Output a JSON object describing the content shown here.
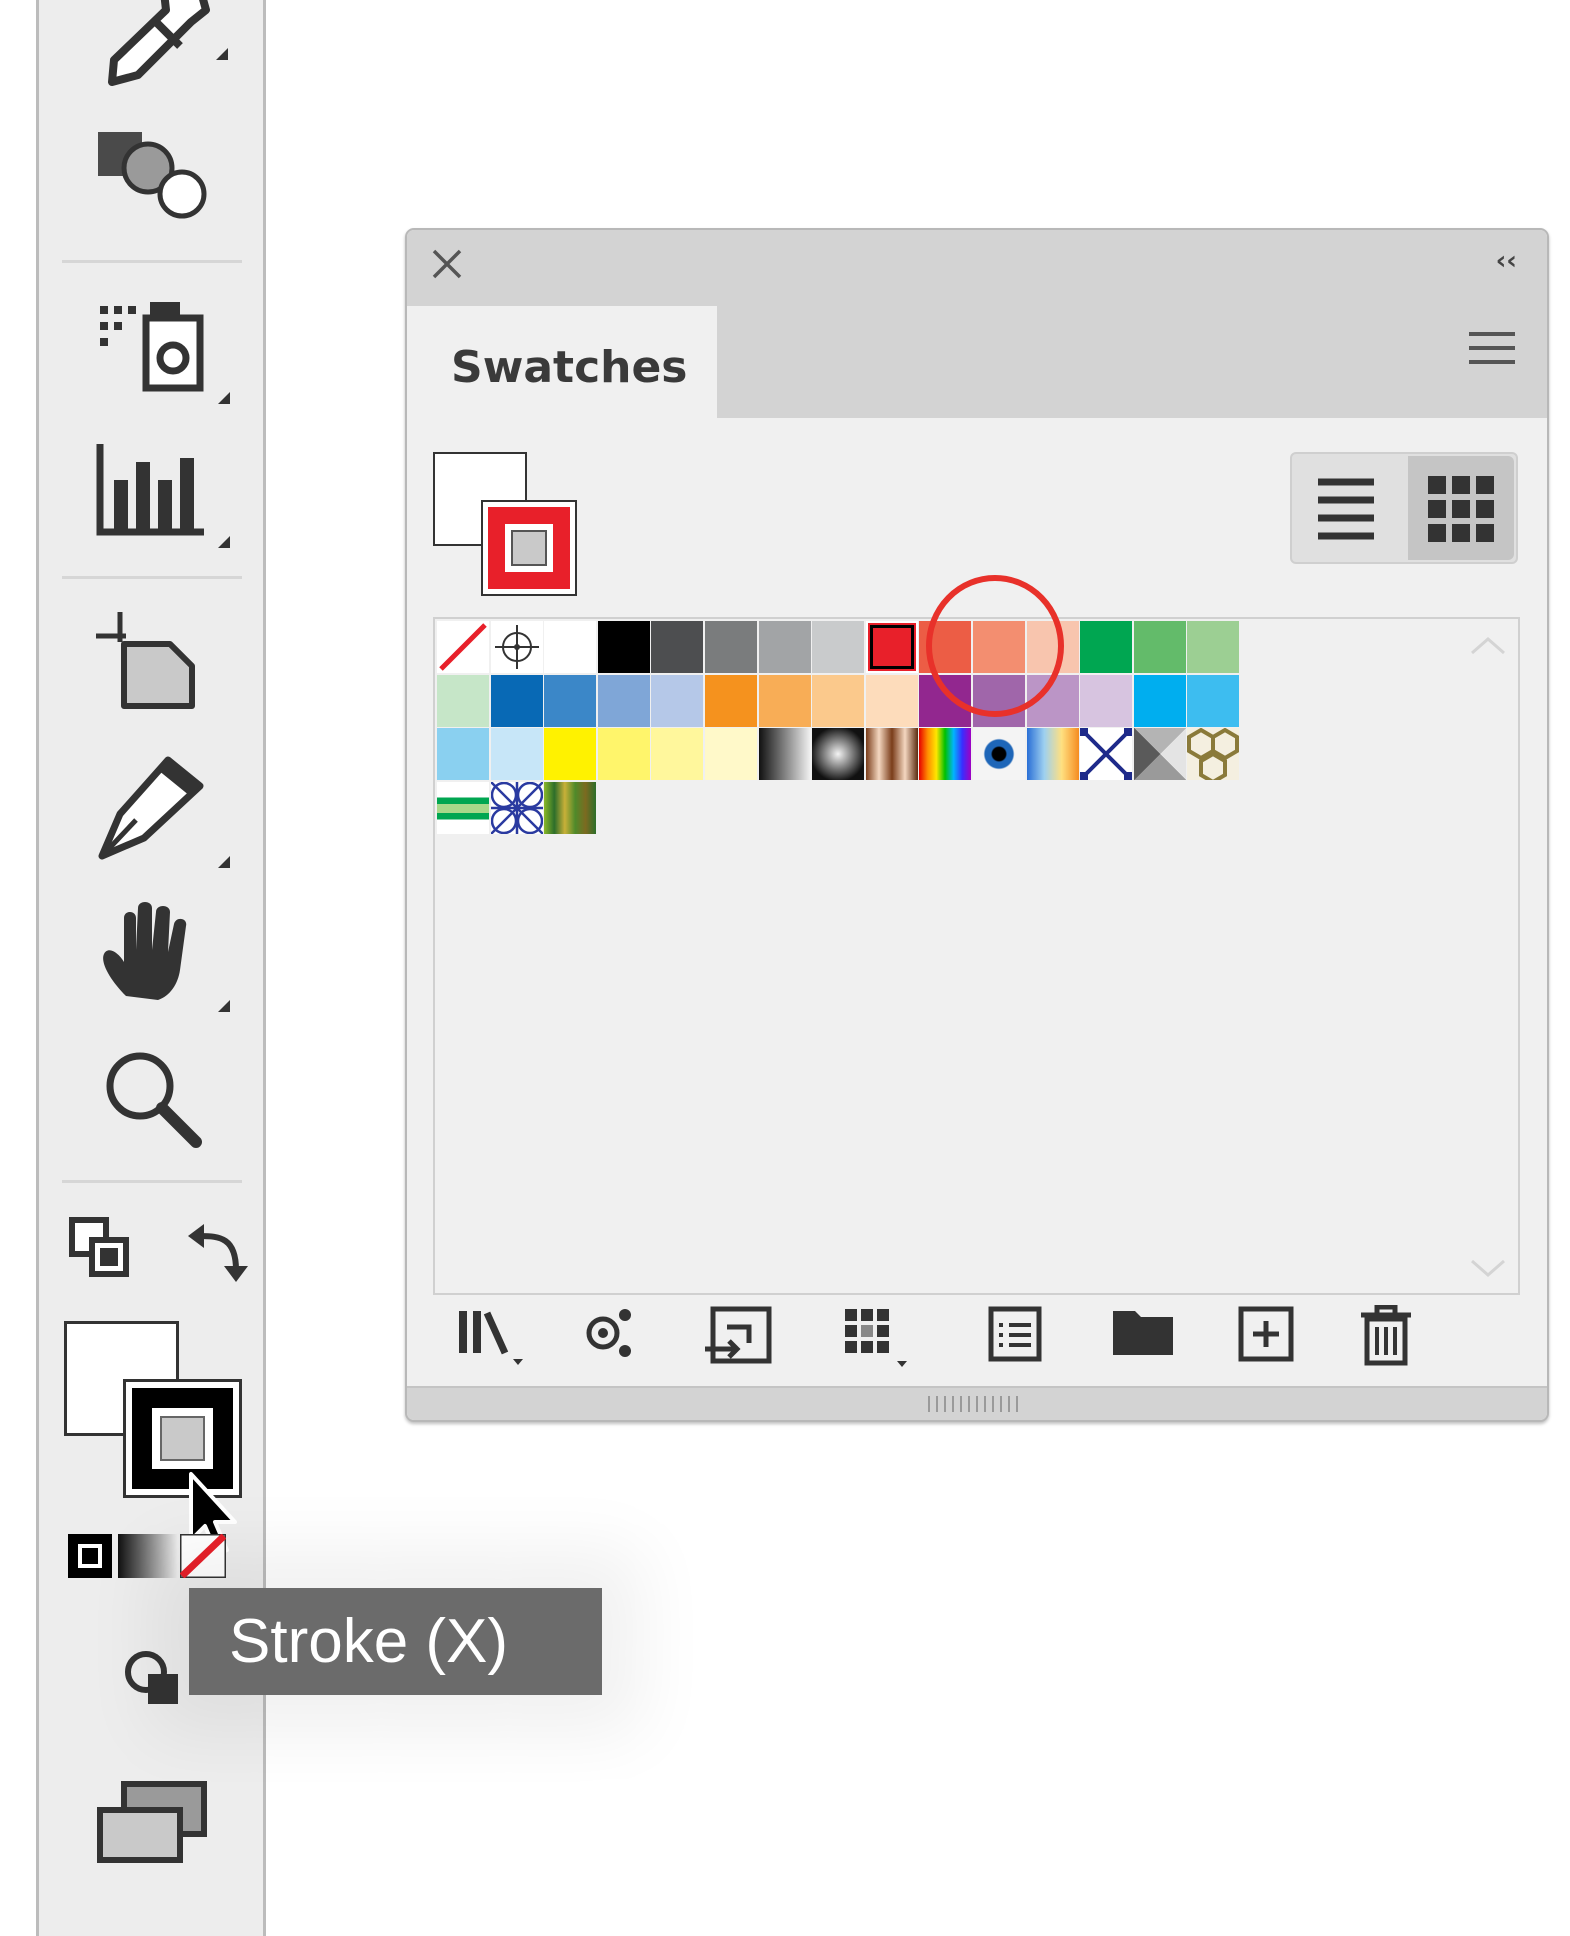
{
  "panel": {
    "tab_title": "Swatches",
    "collapse_glyph": "‹‹"
  },
  "tooltip": {
    "text": "Stroke (X)"
  },
  "colors": {
    "highlight_circle": "#e8312a",
    "selected_stroke": "#e8202a",
    "tooltip_bg": "#6b6b6b"
  },
  "icons": {
    "tools": [
      "eyedropper-icon",
      "shape-builder-icon",
      "symbol-sprayer-icon",
      "column-graph-icon",
      "artboard-icon",
      "slice-icon",
      "hand-icon",
      "zoom-icon",
      "default-fill-stroke-icon",
      "swap-fill-stroke-icon",
      "fill-swatch",
      "stroke-swatch",
      "color-mode-icon",
      "gradient-mode-icon",
      "none-mode-icon",
      "drawing-modes-icon",
      "screen-mode-icon"
    ],
    "panel_bottom": [
      "swatch-libraries-icon",
      "show-swatch-kinds-icon",
      "swatch-options-icon",
      "color-group-icon",
      "new-color-group-icon",
      "folder-icon",
      "new-swatch-icon",
      "delete-swatch-icon"
    ]
  },
  "swatches": {
    "row1": [
      "none",
      "registration",
      "#ffffff",
      "#000000",
      "#4d4e50",
      "#7a7c7d",
      "#a2a4a6",
      "#c9cbcc",
      "#e8202a",
      "#ec5d45",
      "#f38e70",
      "#f8c5ae",
      "#00a651",
      "#63bb6a",
      "#9ccf93"
    ],
    "row2": [
      "#c6e6c8",
      "#0869b5",
      "#3b87c8",
      "#7fa6d7",
      "#b5c8e8",
      "#f5921e",
      "#f8ad56",
      "#fbc98c",
      "#fddcbb",
      "#92278f",
      "#a066aa",
      "#bb95c6",
      "#d7c4e0",
      "#00aeef",
      "#3dbdf0"
    ],
    "row3": [
      "#8ad0f0",
      "#c7e6f8",
      "#fff200",
      "#fff56b",
      "#fff79c",
      "#fff9c9",
      "gradient-linear-bw",
      "gradient-radial-bw",
      "gradient-copper",
      "gradient-spectrum",
      "gradient-eye",
      "gradient-sunset",
      "pattern-dots",
      "pattern-pyramid",
      "pattern-honeycomb"
    ],
    "row4": [
      "pattern-stripes",
      "pattern-lattice",
      "pattern-camo"
    ]
  }
}
